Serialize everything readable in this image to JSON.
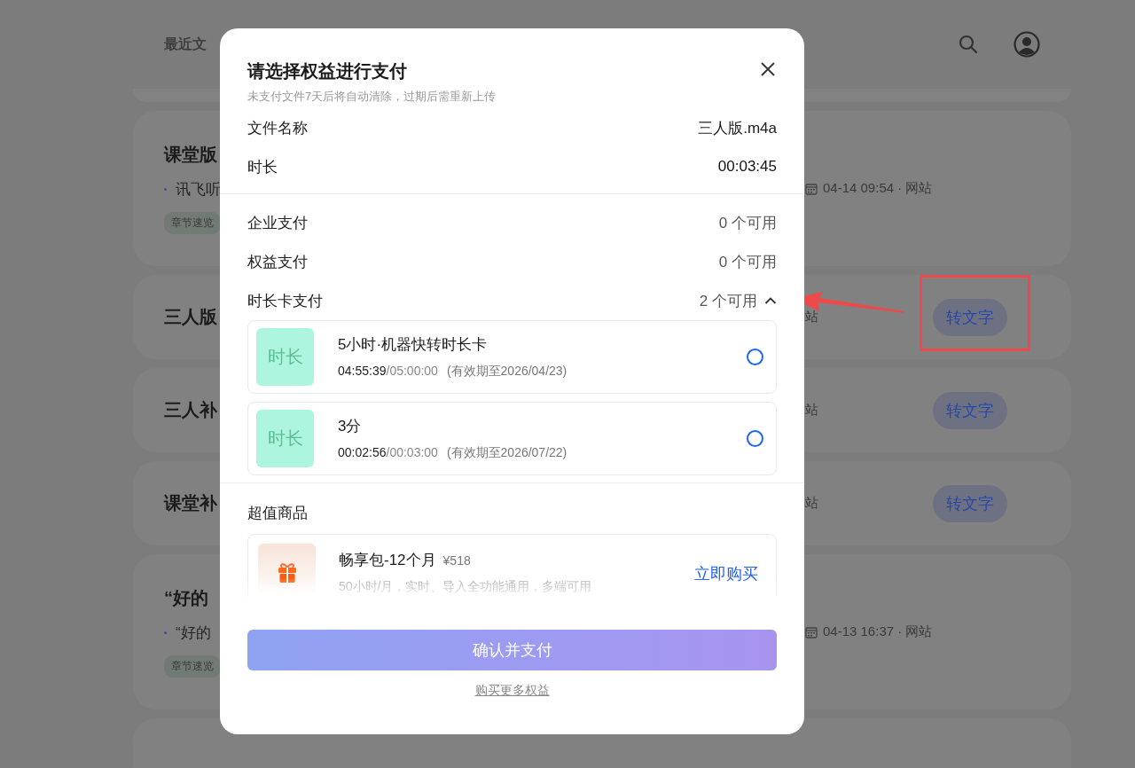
{
  "background": {
    "header_title": "最近文",
    "files": [
      {
        "kind": "summary",
        "title": "课堂版",
        "bullet": "讯飞听",
        "tag": "章节速览",
        "meta": "04-14 09:54 · 网站"
      },
      {
        "kind": "convert",
        "title": "三人版",
        "meta": "站",
        "action": "转文字",
        "highlighted": true
      },
      {
        "kind": "convert",
        "title": "三人补",
        "meta": "站",
        "action": "转文字",
        "highlighted": false
      },
      {
        "kind": "convert",
        "title": "课堂补",
        "meta": "站",
        "action": "转文字",
        "highlighted": false
      },
      {
        "kind": "summary",
        "title": "“好的",
        "bullet": "“好的",
        "tag": "章节速览",
        "meta": "04-13 16:37 · 网站"
      }
    ]
  },
  "dialog": {
    "title": "请选择权益进行支付",
    "subtitle": "未支付文件7天后将自动清除，过期后需重新上传",
    "info": [
      {
        "label": "文件名称",
        "value": "三人版.m4a",
        "kind": "plain"
      },
      {
        "label": "时长",
        "value": "00:03:45",
        "kind": "strong"
      }
    ],
    "payments": [
      {
        "label": "企业支付",
        "value": "0 个可用",
        "kind": "plain"
      },
      {
        "label": "权益支付",
        "value": "0 个可用",
        "kind": "plain"
      },
      {
        "label": "时长卡支付",
        "value": "2 个可用",
        "kind": "collapsible",
        "expanded": true
      }
    ],
    "cards": [
      {
        "badge": "时长",
        "name": "5小时·机器快转时长卡",
        "remaining": "04:55:39",
        "total": "/05:00:00",
        "validity": "(有效期至2026/04/23)",
        "selected": false
      },
      {
        "badge": "时长",
        "name": "3分",
        "remaining": "00:02:56",
        "total": "/00:03:00",
        "validity": "(有效期至2026/07/22)",
        "selected": false
      }
    ],
    "offers": {
      "heading": "超值商品",
      "items": [
        {
          "name": "畅享包-12个月",
          "price": "¥518",
          "description": "50小时/月，实时、导入全功能通用，多端可用",
          "action": "立即购买"
        }
      ]
    },
    "confirm": {
      "label": "确认并支付",
      "disabled": true
    },
    "more_link": "购买更多权益"
  }
}
